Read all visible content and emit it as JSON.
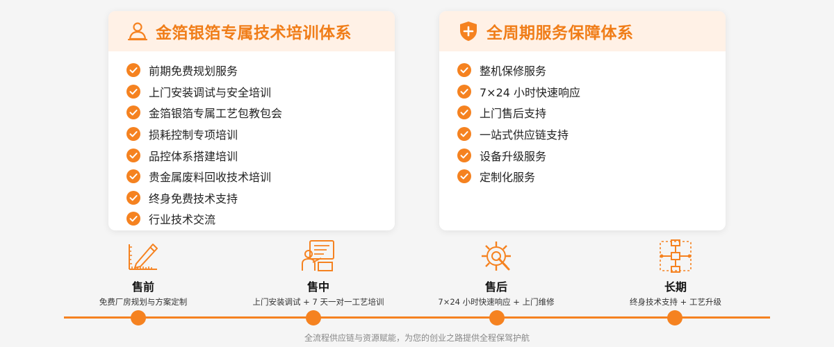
{
  "training": {
    "title": "金箔银箔专属技术培训体系",
    "items": [
      "前期免费规划服务",
      "上门安装调试与安全培训",
      "金箔银箔专属工艺包教包会",
      "损耗控制专项培训",
      "品控体系搭建培训",
      "贵金属废料回收技术培训",
      "终身免费技术支持",
      "行业技术交流"
    ]
  },
  "service": {
    "title": "全周期服务保障体系",
    "items": [
      "整机保修服务",
      "7×24 小时快速响应",
      "上门售后支持",
      "一站式供应链支持",
      "设备升级服务",
      "定制化服务"
    ]
  },
  "timeline": {
    "stages": [
      {
        "title": "售前",
        "desc": "免费厂房规划与方案定制",
        "icon": "ruler-pencil-icon"
      },
      {
        "title": "售中",
        "desc": "上门安装调试 + 7 天一对一工艺培训",
        "icon": "training-icon"
      },
      {
        "title": "售后",
        "desc": "7×24 小时快速响应 + 上门维修",
        "icon": "gear-wrench-icon"
      },
      {
        "title": "长期",
        "desc": "终身技术支持 + 工艺升级",
        "icon": "upgrade-icon"
      }
    ],
    "footer": "全流程供应链与资源赋能，为您的创业之路提供全程保驾护航"
  },
  "colors": {
    "accent": "#f58220",
    "title": "#f07d18",
    "header_bg": "#fff1e6",
    "page_bg": "#f5f5f5"
  }
}
